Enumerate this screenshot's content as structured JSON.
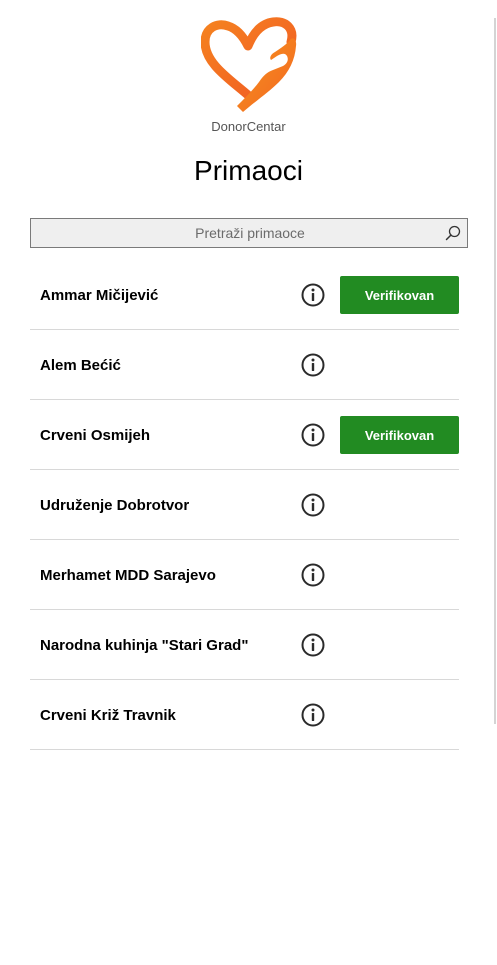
{
  "app": {
    "brand": "DonorCentar",
    "logo_icon": "heart-hand-icon"
  },
  "header": {
    "title": "Primaoci"
  },
  "search": {
    "placeholder": "Pretraži primaoce",
    "value": "",
    "icon": "search-icon"
  },
  "colors": {
    "accent_orange": "#f47a20",
    "verified_green": "#228b22",
    "divider": "#d8d8d8"
  },
  "recipients": [
    {
      "name": "Ammar Mičijević",
      "verified": true,
      "badge_label": "Verifikovan"
    },
    {
      "name": "Alem Bećić",
      "verified": false,
      "badge_label": ""
    },
    {
      "name": "Crveni Osmijeh",
      "verified": true,
      "badge_label": "Verifikovan"
    },
    {
      "name": "Udruženje Dobrotvor",
      "verified": false,
      "badge_label": ""
    },
    {
      "name": "Merhamet MDD Sarajevo",
      "verified": false,
      "badge_label": ""
    },
    {
      "name": "Narodna kuhinja \"Stari Grad\"",
      "verified": false,
      "badge_label": ""
    },
    {
      "name": "Crveni Križ Travnik",
      "verified": false,
      "badge_label": ""
    }
  ]
}
